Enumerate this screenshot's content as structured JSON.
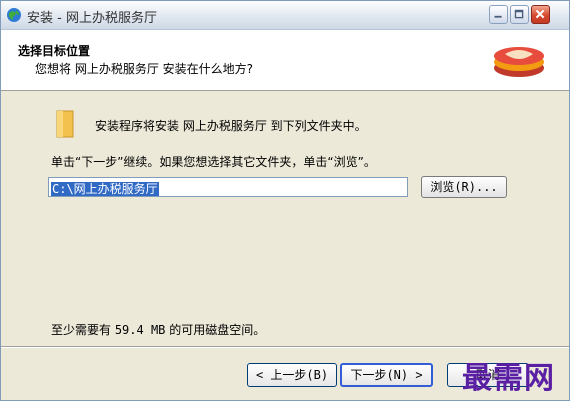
{
  "window": {
    "title": "安装 - 网上办税服务厅",
    "icons": {
      "app": "globe-icon",
      "minimize": "minimize-icon",
      "maximize": "maximize-icon",
      "close": "close-icon"
    }
  },
  "header": {
    "title": "选择目标位置",
    "subtitle": "您想将 网上办税服务厅 安装在什么地方?"
  },
  "body": {
    "info": "安装程序将安装 网上办税服务厅 到下列文件夹中。",
    "hint": "单击“下一步”继续。如果您想选择其它文件夹，单击“浏览”。",
    "path_value": "C:\\网上办税服务厅",
    "browse_label": "浏览(R)...",
    "space_prefix": "至少需要有 ",
    "space_amount": "59.4 MB",
    "space_suffix": " 的可用磁盘空间。"
  },
  "buttons": {
    "back": "< 上一步(B)",
    "next": "下一步(N) >",
    "cancel": "取消"
  },
  "watermark": "最需网",
  "colors": {
    "selection": "#316ac5",
    "watermark": "#5a1fa3",
    "close": "#d5492e"
  }
}
